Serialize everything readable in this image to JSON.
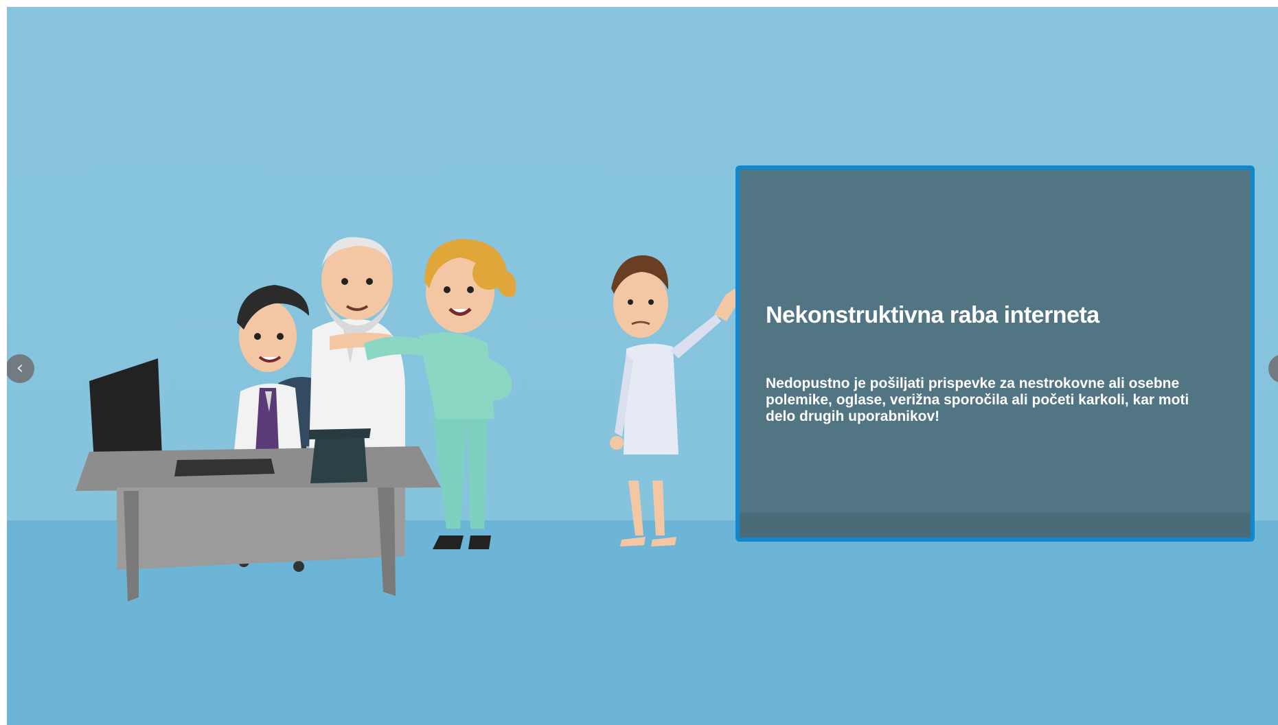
{
  "slide": {
    "title": "Nekonstruktivna raba interneta",
    "body": "Nedopustno je pošiljati prispevke za nestrokovne ali osebne polemike, oglase, verižna sporočila ali početi karkoli, kar moti delo drugih uporabnikov!"
  },
  "nav": {
    "prev_icon": "chevron-left-icon",
    "next_icon": "chevron-right-icon",
    "prev_glyph": "‹",
    "next_glyph": "›"
  },
  "colors": {
    "wall": "#88c4de",
    "floor": "#6cb5d6",
    "panel": "#527583",
    "panel_border": "#1187cf"
  }
}
